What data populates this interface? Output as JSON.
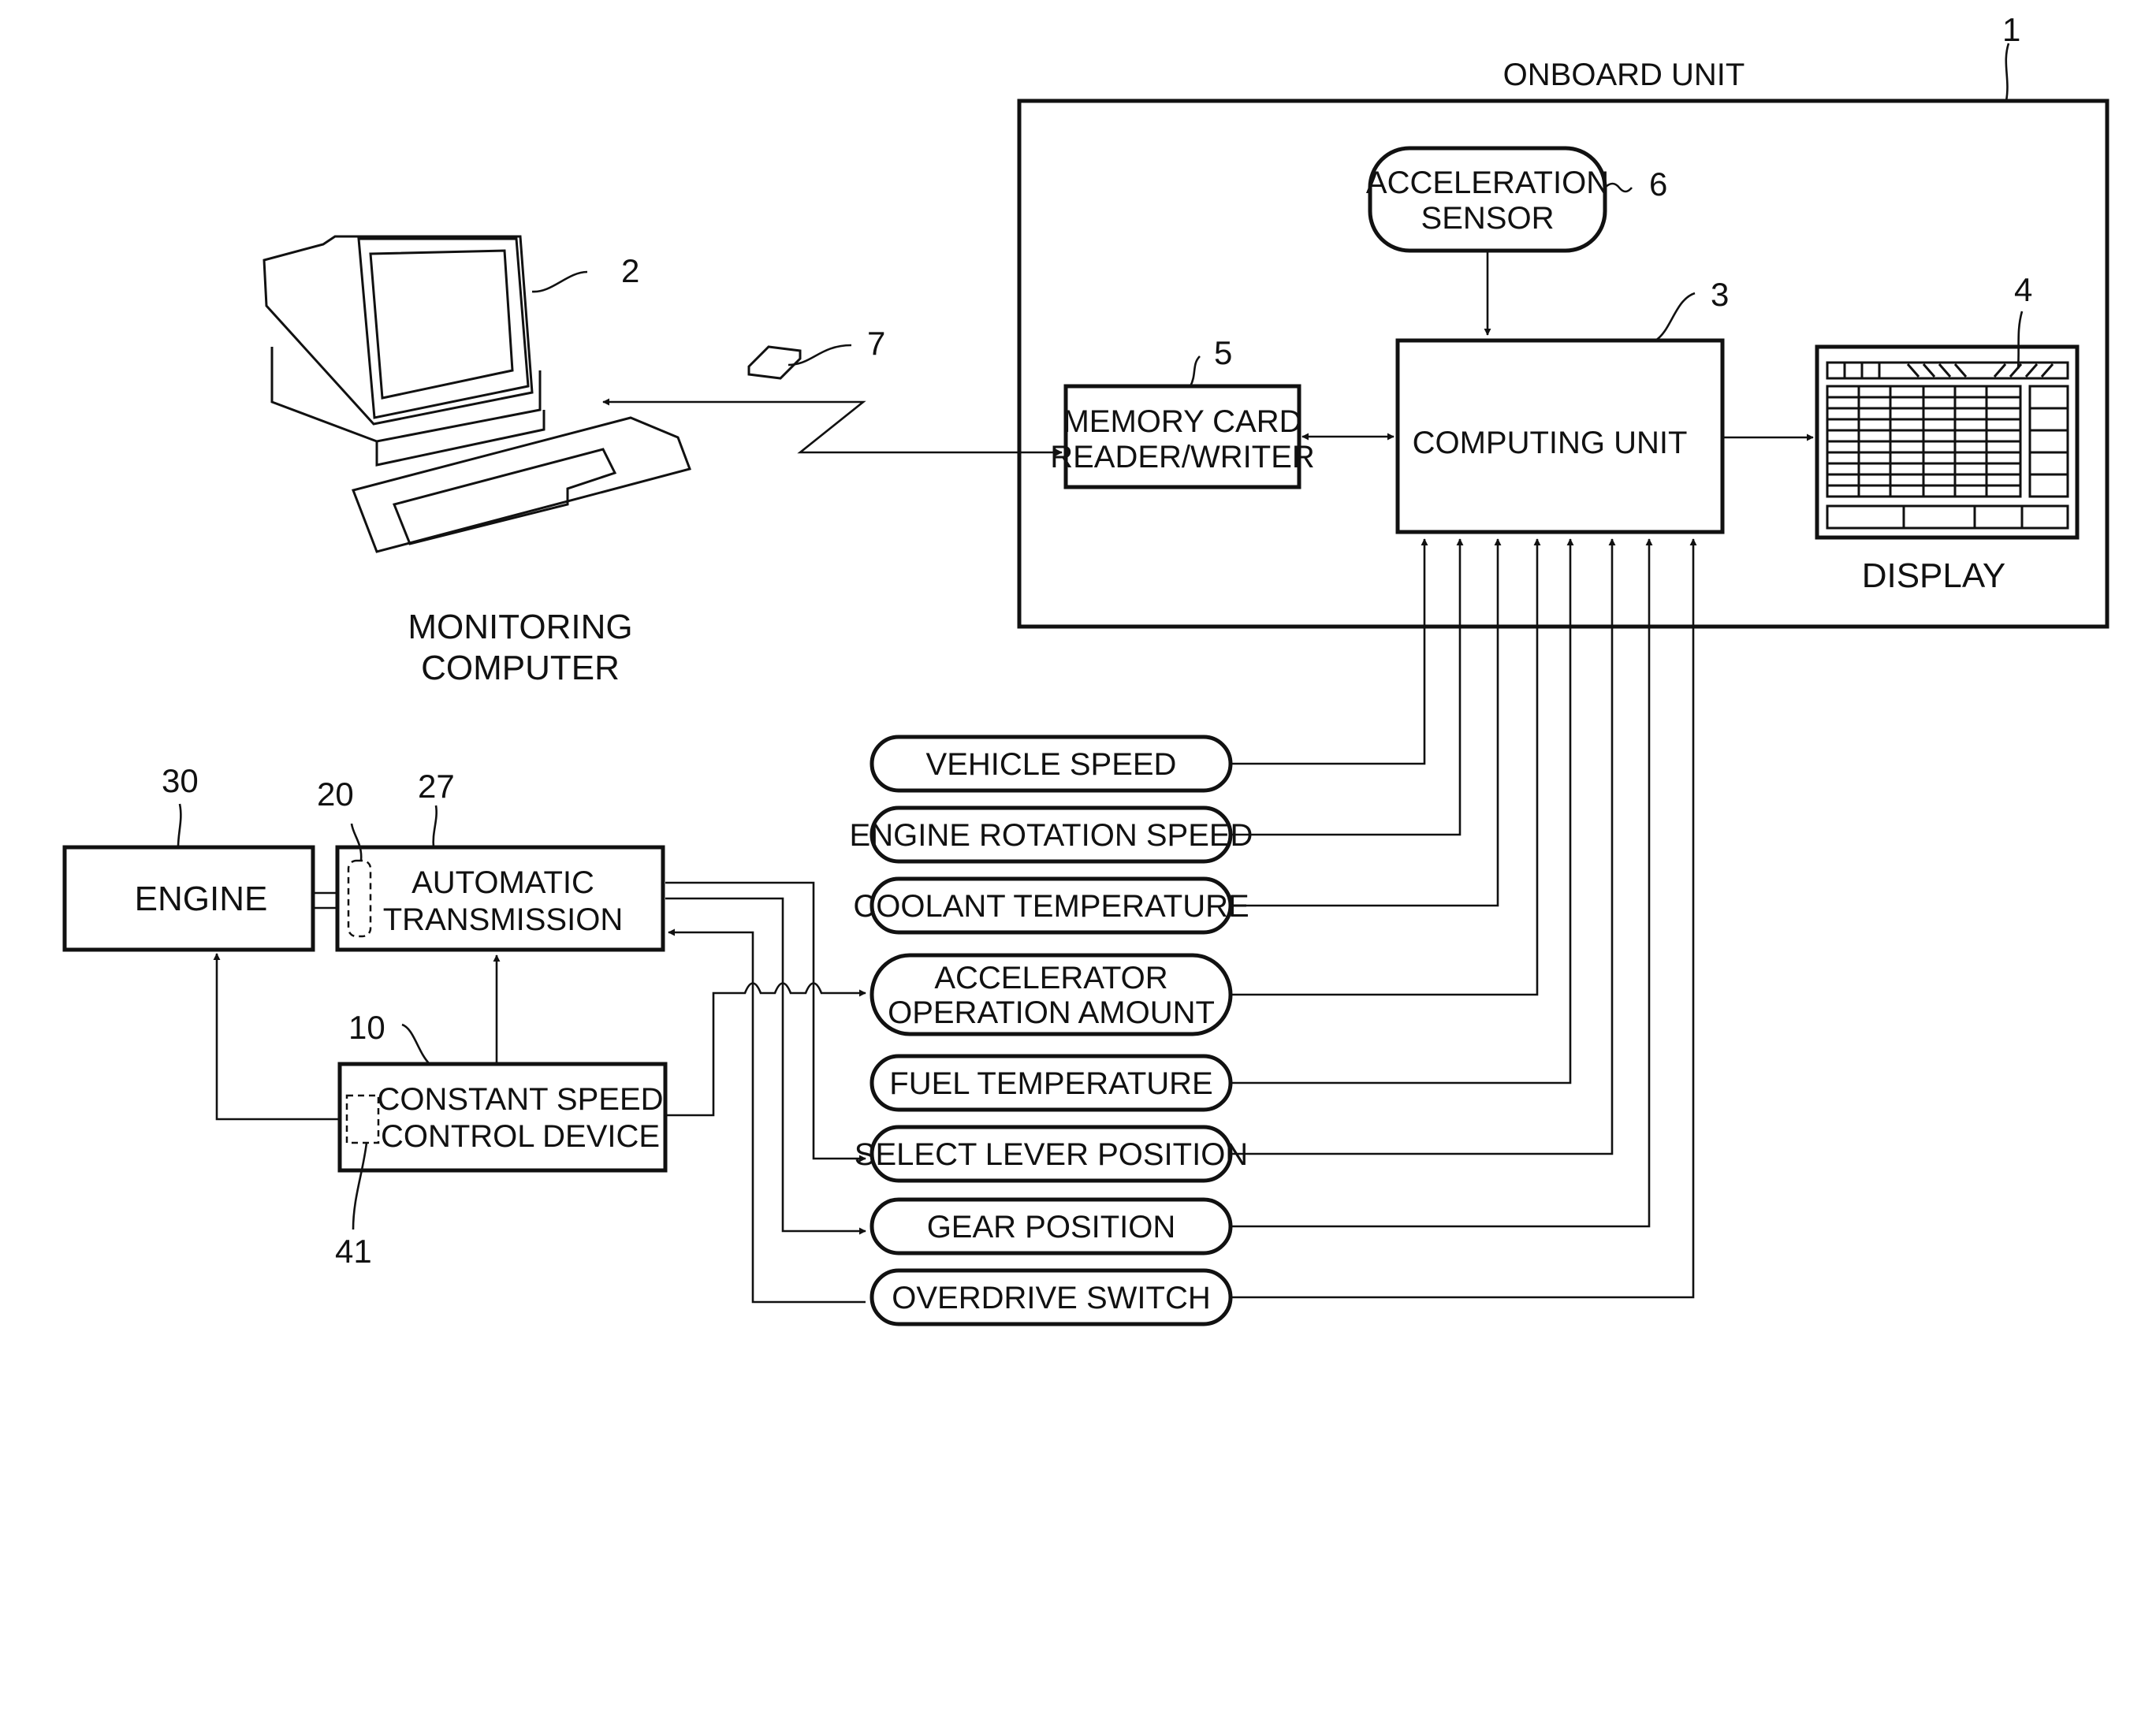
{
  "diagram": {
    "onboard_unit": {
      "title": "ONBOARD UNIT",
      "ref": "1"
    },
    "acceleration_sensor": {
      "lines": [
        "ACCELERATION",
        "SENSOR"
      ],
      "ref": "6"
    },
    "computing_unit": {
      "label": "COMPUTING  UNIT",
      "ref": "3"
    },
    "memory_card_rw": {
      "lines": [
        "MEMORY CARD",
        "READER/WRITER"
      ],
      "ref": "5"
    },
    "display": {
      "label": "DISPLAY",
      "ref": "4"
    },
    "monitoring_computer": {
      "lines": [
        "MONITORING",
        "COMPUTER"
      ],
      "ref": "2"
    },
    "memory_card": {
      "ref": "7"
    },
    "engine": {
      "label": "ENGINE",
      "ref": "30"
    },
    "torque_converter": {
      "ref": "20"
    },
    "automatic_transmission": {
      "lines": [
        "AUTOMATIC",
        "TRANSMISSION"
      ],
      "ref": "27"
    },
    "constant_speed_control": {
      "lines": [
        "CONSTANT SPEED",
        "CONTROL DEVICE"
      ],
      "ref": "10"
    },
    "control_sub_unit": {
      "ref": "41"
    },
    "signals": [
      {
        "lines": [
          "VEHICLE SPEED"
        ]
      },
      {
        "lines": [
          "ENGINE  ROTATION SPEED"
        ]
      },
      {
        "lines": [
          "COOLANT TEMPERATURE"
        ]
      },
      {
        "lines": [
          "ACCELERATOR",
          "OPERATION  AMOUNT"
        ]
      },
      {
        "lines": [
          "FUEL  TEMPERATURE"
        ]
      },
      {
        "lines": [
          "SELECT LEVER  POSITION"
        ]
      },
      {
        "lines": [
          "GEAR POSITION"
        ]
      },
      {
        "lines": [
          "OVERDRIVE SWITCH"
        ]
      }
    ]
  }
}
